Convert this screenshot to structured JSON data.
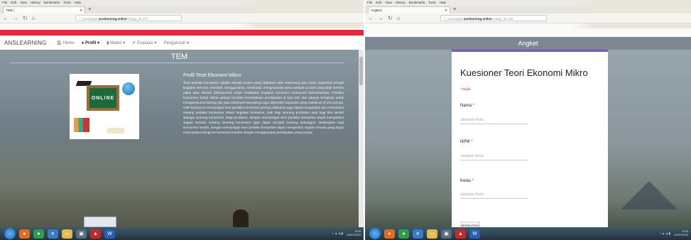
{
  "menu_items": [
    "File",
    "Edit",
    "View",
    "History",
    "Bookmarks",
    "Tools",
    "Help"
  ],
  "left": {
    "tab_title": "TEM |",
    "url_prefix": "ⓘ unsiwagati.",
    "url_domain": "anslearning.online",
    "url_path": "/?page_id=277",
    "brand": "ANSLEARNING",
    "nav": {
      "home": "Home",
      "profil": "Profil",
      "materi": "Materi",
      "evaluasi": "Evaluasi",
      "pengaturan": "Pengaturan"
    },
    "page_heading": "TEM",
    "image_text": "ONLINE",
    "article_title": "Profil Teori Ekonomi Mikro",
    "article_body": "Teori perilaku konsumen adalah sebuah proses yang dilakukan oleh seseorang atau suatu organisasi berupa kegiatan mencari, membeli, menggunakan, menikmati, mengevaluasi serta melepas produk yang telah mereka pakai atau nikmati (dikonsumsi) untuk melakukan kegiatan konsumsi memenuhi kebutuhannya. Perilaku konsumen timbul akibat adanya kendala keterbatasan pendapatan di satu sisi, dan adanya keinginan untuk mengkonsumsi barang dan jasa sebanyak-banyaknya agar diperoleh kepuasan yang maksimal di sisi lainnya. Oleh karena itu mempelajari teori perilaku konsumen penting dilakukan agar dapat mengetahui dan memahami tentang perilaku konsumen dalam kegiatan konsumsi, baik bagi seorang produsen atau bagi kita sendiri sebagai seorang konsumen. Bagi produsen, dengan mempelajari teori perilaku konsumen dapat mengetahui segala sesuatu tentang seorang konsumen agar dapat menjadi seorang pelanggan. Sedangkan bagi konsumen sendiri, dengan mempelajari teori perilaku konsumen dapat mengetahui segala sesuatu yang dapat memuaskan keinginan konsumsi mereka dengan menggunakan pendapatan yang sesuai.",
    "clock_time": "6:20",
    "clock_date": "12/07/2019"
  },
  "right": {
    "tab_title": "Angket |",
    "url_prefix": "ⓘ unsiwagati.",
    "url_domain": "anslearning.online",
    "url_path": "/?page_id=239",
    "header": "Angket",
    "form_title": "Kuesioner Teori Ekonomi Mikro",
    "required_note": "* Wajib",
    "fields": [
      {
        "label": "Nama",
        "placeholder": "Jawaban Anda"
      },
      {
        "label": "NPM",
        "placeholder": "Jawaban Anda"
      },
      {
        "label": "Kelas",
        "placeholder": "Jawaban Anda"
      }
    ],
    "required_mark": "*",
    "next_button": "BERIKUTNYA",
    "clock_time": "6:03",
    "clock_date": "12/07/2019"
  },
  "colors": {
    "brand_red": "#e7273b",
    "form_accent": "#7e57c2",
    "required_red": "#d93025"
  },
  "icons": [
    "back-arrow-icon",
    "forward-arrow-icon",
    "reload-icon",
    "home-icon",
    "user-icon",
    "book-icon",
    "check-icon",
    "windows-start-icon",
    "firefox-icon",
    "chrome-icon",
    "folder-icon",
    "pdf-icon",
    "word-icon"
  ]
}
